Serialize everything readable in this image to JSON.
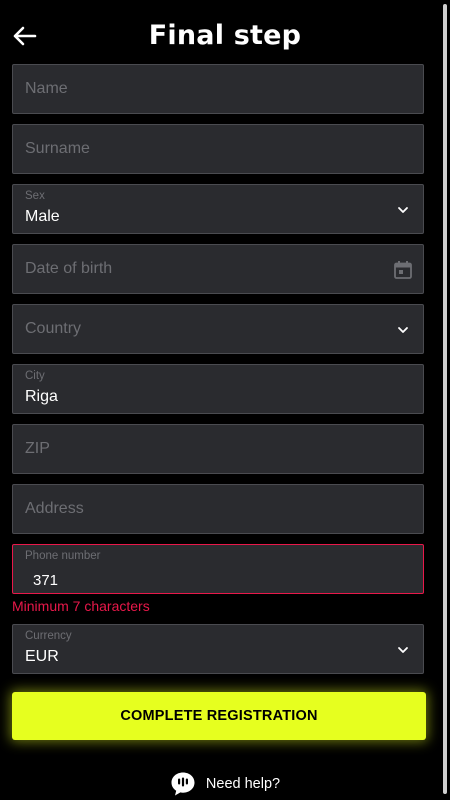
{
  "header": {
    "title": "Final step"
  },
  "form": {
    "name": {
      "placeholder": "Name"
    },
    "surname": {
      "placeholder": "Surname"
    },
    "sex": {
      "label": "Sex",
      "value": "Male"
    },
    "dob": {
      "placeholder": "Date of birth"
    },
    "country": {
      "placeholder": "Country"
    },
    "city": {
      "label": "City",
      "value": "Riga"
    },
    "zip": {
      "placeholder": "ZIP"
    },
    "address": {
      "placeholder": "Address"
    },
    "phone": {
      "label": "Phone number",
      "value": "371",
      "error": "Minimum 7 characters"
    },
    "currency": {
      "label": "Currency",
      "value": "EUR"
    }
  },
  "actions": {
    "submit_label": "COMPLETE REGISTRATION",
    "help_label": "Need help?"
  },
  "colors": {
    "background": "#000000",
    "field_bg": "#2a2b2f",
    "accent": "#e6ff1f",
    "error": "#e8184a"
  },
  "icons": {
    "back": "arrow-left-icon",
    "dropdown": "chevron-down-icon",
    "calendar": "calendar-icon",
    "help": "chat-bubble-icon"
  }
}
